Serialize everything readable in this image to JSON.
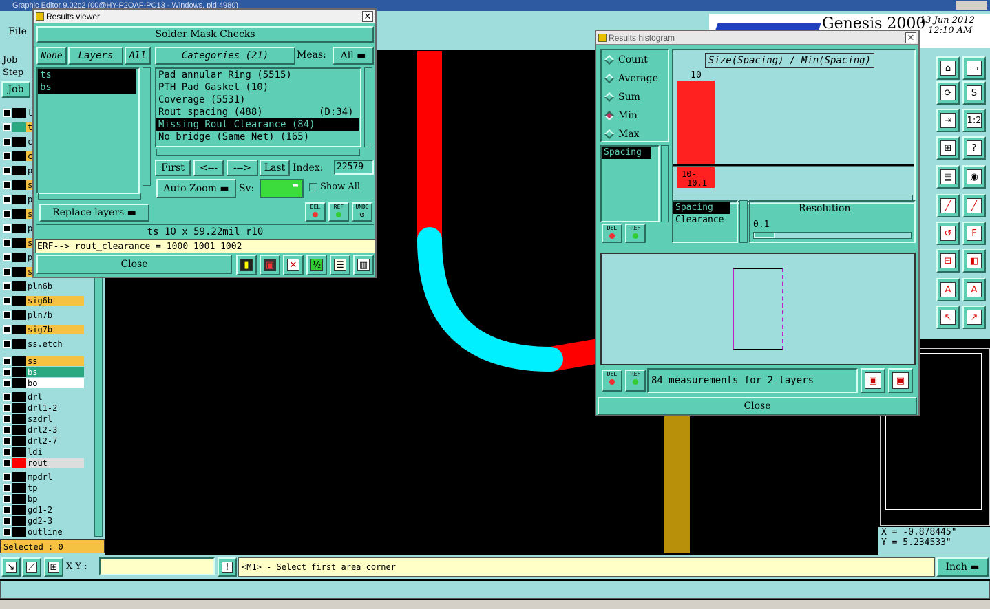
{
  "app": {
    "title": "Graphic Editor 9.02c2 (00@HY-P2OAF-PC13 - Windows, pid:4980)",
    "menu_file": "File",
    "brand": "Genesis 2000",
    "date": "13 Jun 2012",
    "time": "12:10 AM"
  },
  "left": {
    "job_label": "Job",
    "step_label": "Step",
    "job_button": "Job",
    "layers": [
      "t",
      "t",
      "c",
      "c",
      "p",
      "s",
      "p",
      "s",
      "p",
      "s",
      "p",
      "s",
      "pln6b",
      "sig6b",
      "pln7b",
      "sig7b",
      "ss.etch",
      "ss",
      "bs",
      "bo",
      "drl",
      "drl1-2",
      "szdrl",
      "drl2-3",
      "drl2-7",
      "ldi",
      "rout",
      "mpdrl",
      "tp",
      "bp",
      "gd1-2",
      "gd2-3",
      "outline"
    ],
    "selected_text": "Selected : 0"
  },
  "results_viewer": {
    "window_title": "Results viewer",
    "header": "Solder Mask Checks",
    "none_btn": "None",
    "layers_btn": "Layers",
    "all_btn": "All",
    "categories_btn": "Categories (21)",
    "meas_label": "Meas:",
    "meas_value": "All",
    "layer_list": [
      "ts",
      "bs"
    ],
    "categories": [
      {
        "name": "Pad annular Ring (5515)",
        "extra": ""
      },
      {
        "name": "PTH Pad Gasket (10)",
        "extra": ""
      },
      {
        "name": "Coverage (5531)",
        "extra": ""
      },
      {
        "name": "Rout spacing (488)",
        "extra": "(D:34)"
      },
      {
        "name": "Missing Rout Clearance (84)",
        "extra": ""
      },
      {
        "name": "No bridge (Same Net) (165)",
        "extra": ""
      }
    ],
    "first_btn": "First",
    "prev_btn": "<---",
    "next_btn": "--->",
    "last_btn": "Last",
    "index_label": "Index:",
    "index_value": "22579",
    "autozoom_btn": "Auto Zoom",
    "sv_label": "Sv:",
    "show_all_label": "Show All",
    "replace_btn": "Replace layers",
    "del_label": "DEL",
    "ref_label": "REF",
    "undo_label": "UNDO",
    "info_line": "ts 10 x 59.22mil  r10",
    "erf_line": "ERF--> rout_clearance = 1000 1001 1002",
    "close_btn": "Close"
  },
  "histogram": {
    "window_title": "Results histogram",
    "modes": [
      "Count",
      "Average",
      "Sum",
      "Min",
      "Max"
    ],
    "selected_mode": "Min",
    "chart_title": "Size(Spacing) / Min(Spacing)",
    "param_list": [
      "Spacing"
    ],
    "bar_value_label": "10",
    "bar_range_label": "10-\n10.1",
    "type_list": [
      "Spacing",
      "Clearance"
    ],
    "resolution_label": "Resolution",
    "resolution_value": "0.1",
    "del_label": "DEL",
    "ref_label": "REF",
    "summary": "84 measurements for 2 layers",
    "close_btn": "Close",
    "chart_data": {
      "type": "bar",
      "title": "Size(Spacing) / Min(Spacing)",
      "categories": [
        "10-10.1"
      ],
      "values": [
        10
      ]
    }
  },
  "coords": {
    "x": "X = -0.878445\"",
    "y": "Y = 5.234533\""
  },
  "status": {
    "xy_label": "X Y :",
    "xy_value": "",
    "prompt": "<M1> - Select first area corner",
    "unit": "Inch"
  },
  "colors": {
    "teal": "#5ecfb4",
    "light": "#9fdcdc",
    "red_trace": "#ff0000",
    "cyan_arc": "#00f0ff",
    "gold": "#b8900a"
  }
}
